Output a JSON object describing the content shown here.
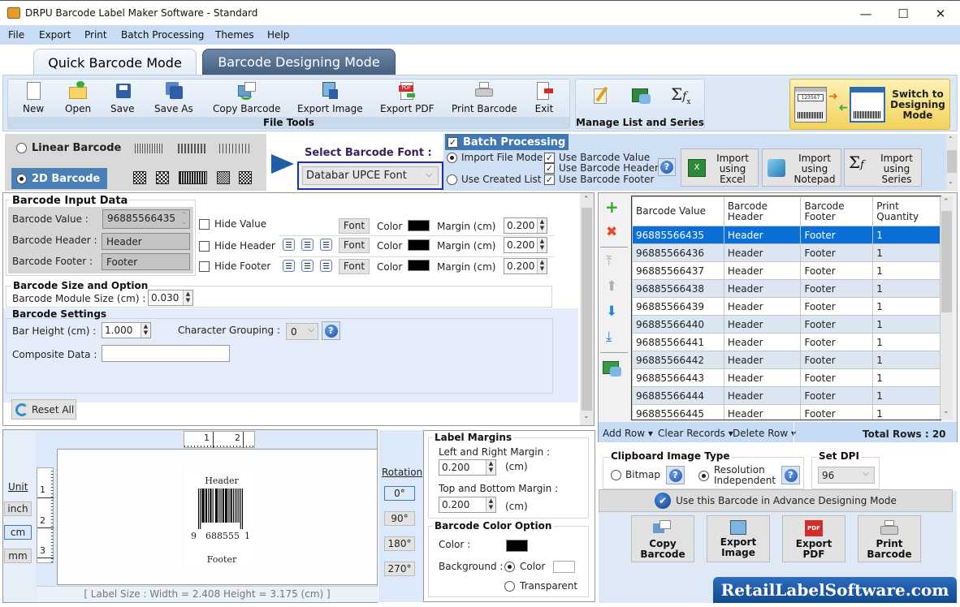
{
  "window": {
    "title": "DRPU Barcode Label Maker Software - Standard",
    "controls": {
      "minimize": "—",
      "maximize": "☐",
      "close": "✕"
    }
  },
  "menu": [
    "File",
    "Export",
    "Print",
    "Batch Processing",
    "Themes",
    "Help"
  ],
  "tabs": {
    "quick": "Quick Barcode Mode",
    "designing": "Barcode Designing Mode"
  },
  "ribbon": {
    "file_tools": {
      "label": "File Tools",
      "items": [
        "New",
        "Open",
        "Save",
        "Save As",
        "Copy Barcode",
        "Export Image",
        "Export PDF",
        "Print Barcode",
        "Exit"
      ]
    },
    "manage": {
      "label": "Manage List and Series"
    },
    "switch": {
      "label1": "Switch to",
      "label2": "Designing",
      "label3": "Mode",
      "sample_value": "123567"
    }
  },
  "barcode_type": {
    "linear": "Linear Barcode",
    "twod": "2D Barcode",
    "selected": "2D Barcode"
  },
  "font_select": {
    "label": "Select Barcode Font :",
    "value": "Databar UPCE Font"
  },
  "batch": {
    "title": "Batch Processing",
    "checked": true,
    "import_file_mode": "Import File Mode",
    "use_created_list": "Use Created List",
    "use_value": "Use Barcode Value",
    "use_header": "Use Barcode Header",
    "use_footer": "Use Barcode Footer",
    "import_excel": [
      "Import",
      "using",
      "Excel"
    ],
    "import_notepad": [
      "Import",
      "using",
      "Notepad"
    ],
    "import_series": [
      "Import",
      "using",
      "Series"
    ]
  },
  "input_data": {
    "title": "Barcode Input Data",
    "value_label": "Barcode Value :",
    "value": "96885566435",
    "header_label": "Barcode Header :",
    "header": "Header",
    "footer_label": "Barcode Footer :",
    "footer": "Footer",
    "hide_value": "Hide Value",
    "hide_header": "Hide Header",
    "hide_footer": "Hide Footer",
    "font": "Font",
    "color": "Color",
    "margin_label": "Margin (cm)",
    "margins": [
      "0.200",
      "0.200",
      "0.200"
    ]
  },
  "size_option": {
    "title": "Barcode Size and Option",
    "module_label": "Barcode Module Size (cm) :",
    "module_value": "0.030"
  },
  "settings": {
    "title": "Barcode Settings",
    "bar_height_label": "Bar Height (cm) :",
    "bar_height": "1.000",
    "grouping_label": "Character Grouping :",
    "grouping": "0",
    "composite_label": "Composite Data :",
    "composite": ""
  },
  "reset": "Reset All",
  "table": {
    "headers": [
      [
        "Barcode Value"
      ],
      [
        "Barcode",
        "Header"
      ],
      [
        "Barcode",
        "Footer"
      ],
      [
        "Print",
        "Quantity"
      ]
    ],
    "rows": [
      [
        "96885566435",
        "Header",
        "Footer",
        "1"
      ],
      [
        "96885566436",
        "Header",
        "Footer",
        "1"
      ],
      [
        "96885566437",
        "Header",
        "Footer",
        "1"
      ],
      [
        "96885566438",
        "Header",
        "Footer",
        "1"
      ],
      [
        "96885566439",
        "Header",
        "Footer",
        "1"
      ],
      [
        "96885566440",
        "Header",
        "Footer",
        "1"
      ],
      [
        "96885566441",
        "Header",
        "Footer",
        "1"
      ],
      [
        "96885566442",
        "Header",
        "Footer",
        "1"
      ],
      [
        "96885566443",
        "Header",
        "Footer",
        "1"
      ],
      [
        "96885566444",
        "Header",
        "Footer",
        "1"
      ],
      [
        "96885566445",
        "Header",
        "Footer",
        "1"
      ]
    ],
    "selected_row": 0,
    "add_row": "Add Row ▾",
    "clear_records": "Clear Records ▾",
    "delete_row": "Delete Row ▾",
    "total_rows": "Total Rows : 20"
  },
  "clipboard": {
    "title": "Clipboard Image Type",
    "bitmap": "Bitmap",
    "resolution": "Resolution",
    "independent": "Independent",
    "dpi_title": "Set DPI",
    "dpi": "96",
    "advance": "Use this Barcode in Advance Designing Mode"
  },
  "actions": [
    {
      "l1": "Copy",
      "l2": "Barcode"
    },
    {
      "l1": "Export",
      "l2": "Image"
    },
    {
      "l1": "Export",
      "l2": "PDF"
    },
    {
      "l1": "Print",
      "l2": "Barcode"
    }
  ],
  "brand": "RetailLabelSoftware.com",
  "preview": {
    "unit_label": "Unit",
    "units": [
      "inch",
      "cm",
      "mm"
    ],
    "active_unit": "cm",
    "ruler_h": [
      "1",
      "2"
    ],
    "ruler_v": [
      "1",
      "2",
      "3"
    ],
    "barcode_header": "Header",
    "barcode_footer": "Footer",
    "digits_left": "9",
    "digits_mid": "688555",
    "digits_right": "1",
    "label_size": "[ Label Size : Width = 2.408  Height = 3.175 (cm) ]"
  },
  "rotation": {
    "label": "Rotation",
    "options": [
      "0°",
      "90°",
      "180°",
      "270°"
    ],
    "active": "0°"
  },
  "label_margins": {
    "title": "Label Margins",
    "lr_label": "Left and Right Margin :",
    "lr": "0.200",
    "tb_label": "Top and Bottom Margin :",
    "tb": "0.200",
    "unit": "(cm)"
  },
  "color_option": {
    "title": "Barcode Color Option",
    "color_label": "Color :",
    "background_label": "Background :",
    "bg_color": "Color",
    "bg_transparent": "Transparent",
    "bar_color": "#000000",
    "bg_value": "#ffffff"
  },
  "colors": {
    "accent": "#3f78b5",
    "selected_row": "#0a6fd6",
    "menubar": "#c8dcf5"
  }
}
